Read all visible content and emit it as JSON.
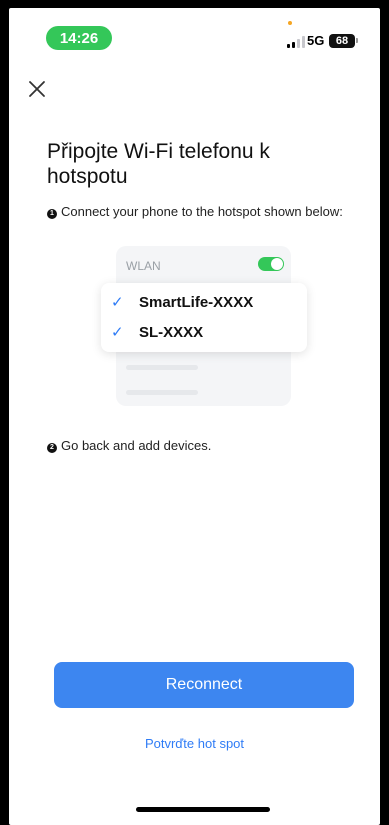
{
  "status_bar": {
    "time": "14:26",
    "network": "5G",
    "battery": "68"
  },
  "header": {
    "close_icon": "close-icon"
  },
  "title": "Připojte Wi-Fi telefonu k hotspotu",
  "steps": [
    {
      "bullet": "1",
      "text": "Connect your phone to the hotspot shown below:"
    },
    {
      "bullet": "2",
      "text": "Go back and add devices."
    }
  ],
  "illustration": {
    "wlan_label": "WLAN",
    "toggle_on": true,
    "networks": [
      {
        "check": "✓",
        "name": "SmartLife-XXXX"
      },
      {
        "check": "✓",
        "name": "SL-XXXX"
      }
    ]
  },
  "actions": {
    "reconnect_label": "Reconnect",
    "confirm_link": "Potvrďte hot spot"
  },
  "colors": {
    "accent": "#3d86f0",
    "link": "#2f7cf6",
    "status_green": "#34c759"
  }
}
